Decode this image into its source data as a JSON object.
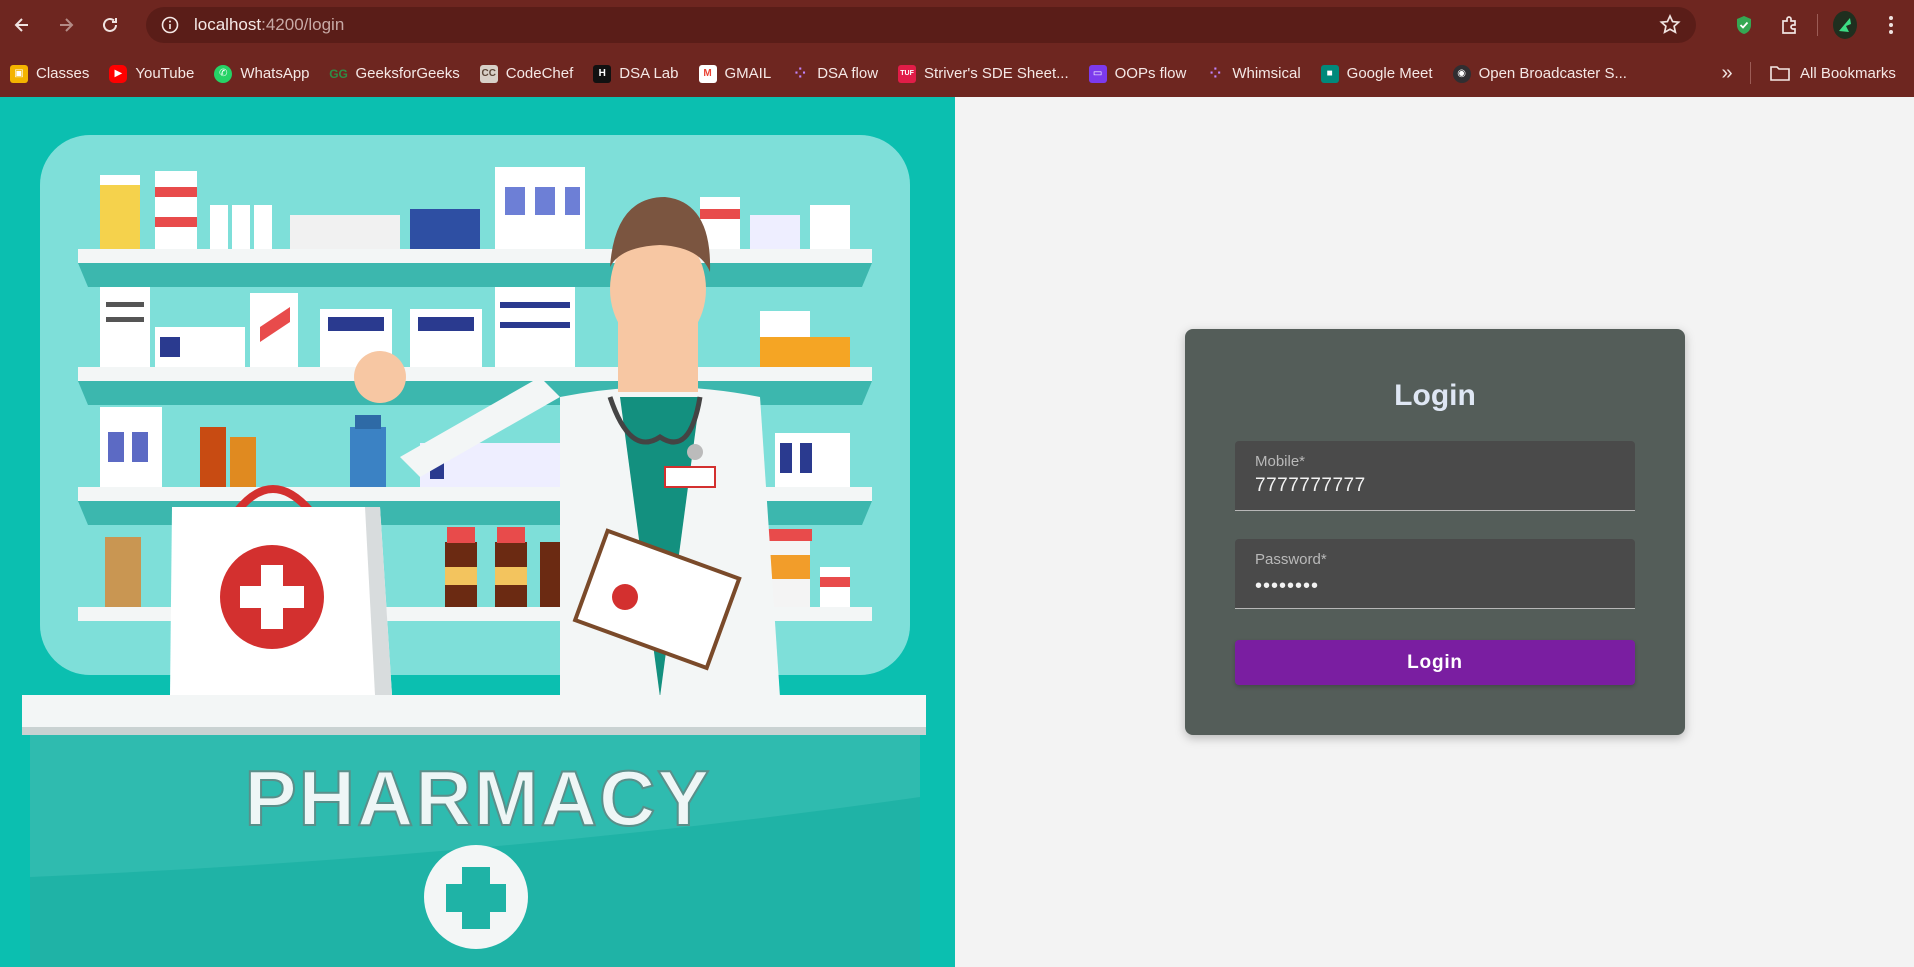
{
  "browser": {
    "url_host": "localhost",
    "url_path": ":4200/login",
    "bookmarks": [
      {
        "label": "Classes",
        "icon": "classroom-icon",
        "color": "#f4b400"
      },
      {
        "label": "YouTube",
        "icon": "youtube-icon",
        "color": "#ff0000"
      },
      {
        "label": "WhatsApp",
        "icon": "whatsapp-icon",
        "color": "#25d366"
      },
      {
        "label": "GeeksforGeeks",
        "icon": "geeksforgeeks-icon",
        "color": "#2f8d46"
      },
      {
        "label": "CodeChef",
        "icon": "codechef-icon",
        "color": "#5b4638"
      },
      {
        "label": "DSA Lab",
        "icon": "hackerrank-icon",
        "color": "#111111"
      },
      {
        "label": "GMAIL",
        "icon": "gmail-icon",
        "color": "#ea4335"
      },
      {
        "label": "DSA flow",
        "icon": "whimsical-icon",
        "color": "#a855f7"
      },
      {
        "label": "Striver's SDE Sheet...",
        "icon": "tuf-icon",
        "color": "#e11d48"
      },
      {
        "label": "OOPs flow",
        "icon": "whimsical-board-icon",
        "color": "#7c3aed"
      },
      {
        "label": "Whimsical",
        "icon": "whimsical-icon",
        "color": "#a855f7"
      },
      {
        "label": "Google Meet",
        "icon": "google-meet-icon",
        "color": "#00897b"
      },
      {
        "label": "Open Broadcaster S...",
        "icon": "obs-icon",
        "color": "#302e31"
      }
    ],
    "all_bookmarks": "All Bookmarks"
  },
  "hero": {
    "sign_text": "PHARMACY"
  },
  "login": {
    "title": "Login",
    "mobile_label": "Mobile*",
    "mobile_value": "7777777777",
    "password_label": "Password*",
    "password_value": "••••••••",
    "button_label": "Login"
  },
  "colors": {
    "chrome": "#6e2620",
    "hero_bg": "#0bbfb0",
    "card_bg": "#545d59",
    "button": "#7a1ea1"
  }
}
